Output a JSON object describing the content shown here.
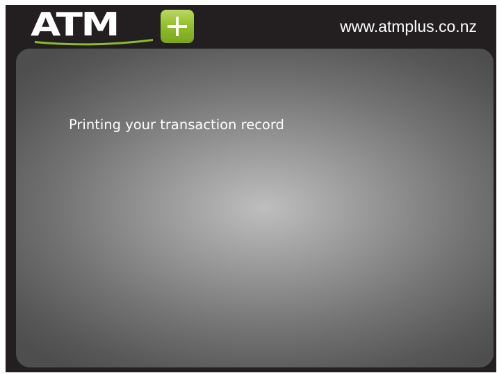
{
  "header": {
    "logo": {
      "wordmark": "ATM",
      "symbol": "+",
      "brand_colors": {
        "green": "#8dbb2a",
        "white": "#ffffff"
      }
    },
    "website": "www.atmplus.co.nz"
  },
  "main": {
    "message": "Printing your transaction record"
  },
  "colors": {
    "frame": "#231f20",
    "panel_center": "#bebebe",
    "panel_edge": "#4e4e4e",
    "text": "#ffffff"
  }
}
